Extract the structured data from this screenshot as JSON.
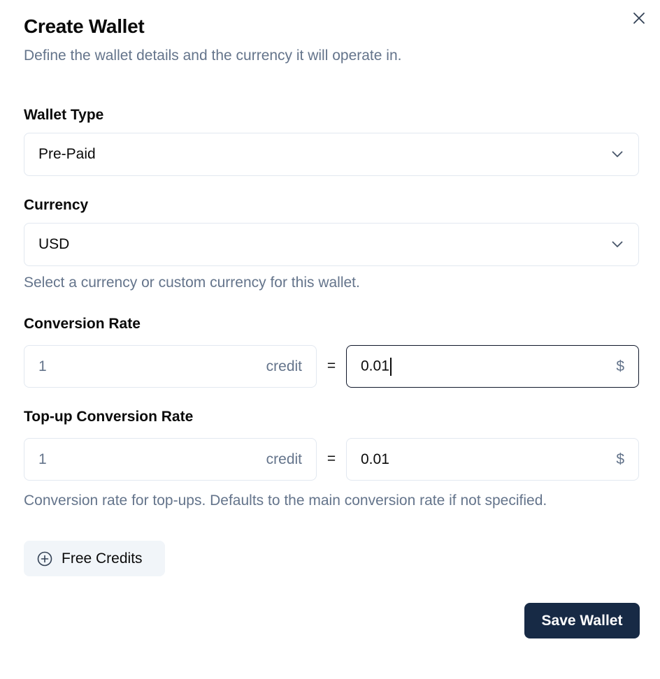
{
  "dialog": {
    "title": "Create Wallet",
    "subtitle": "Define the wallet details and the currency it will operate in.",
    "close_icon": "x-close-icon"
  },
  "wallet_type": {
    "label": "Wallet Type",
    "value": "Pre-Paid"
  },
  "currency": {
    "label": "Currency",
    "value": "USD",
    "help": "Select a currency or custom currency for this wallet."
  },
  "conversion_rate": {
    "label": "Conversion Rate",
    "credit_value": "1",
    "credit_suffix": "credit",
    "equals": "=",
    "currency_value": "0.01",
    "currency_suffix": "$"
  },
  "topup_conversion_rate": {
    "label": "Top-up Conversion Rate",
    "credit_value": "1",
    "credit_suffix": "credit",
    "equals": "=",
    "currency_value": "0.01",
    "currency_suffix": "$",
    "help": "Conversion rate for top-ups. Defaults to the main conversion rate if not specified."
  },
  "free_credits_button": {
    "label": "Free Credits",
    "icon": "plus-circle-icon"
  },
  "save_button": {
    "label": "Save Wallet"
  },
  "colors": {
    "primary_button": "#172a45",
    "muted_text": "#64748b",
    "border": "#e2e8f0"
  }
}
